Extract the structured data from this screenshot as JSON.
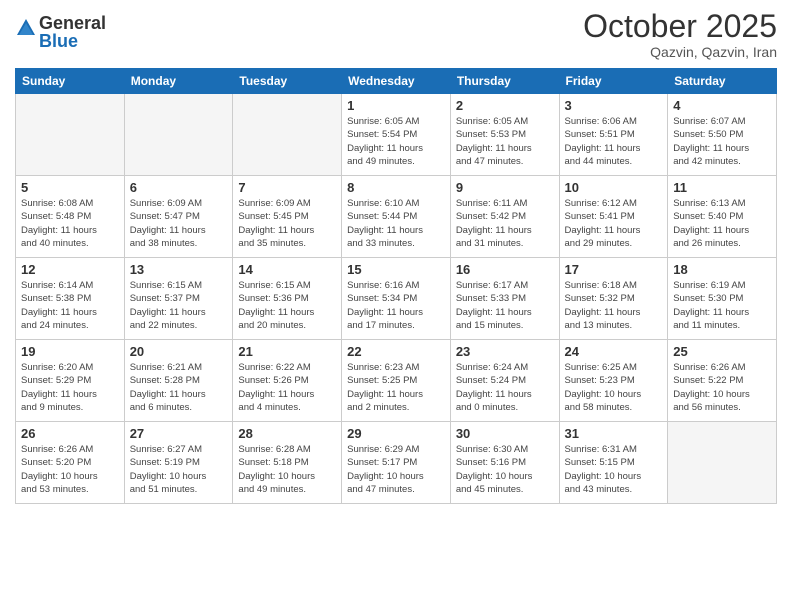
{
  "header": {
    "logo": {
      "general": "General",
      "blue": "Blue"
    },
    "month": "October 2025",
    "location": "Qazvin, Qazvin, Iran"
  },
  "weekdays": [
    "Sunday",
    "Monday",
    "Tuesday",
    "Wednesday",
    "Thursday",
    "Friday",
    "Saturday"
  ],
  "weeks": [
    [
      {
        "day": "",
        "info": ""
      },
      {
        "day": "",
        "info": ""
      },
      {
        "day": "",
        "info": ""
      },
      {
        "day": "1",
        "info": "Sunrise: 6:05 AM\nSunset: 5:54 PM\nDaylight: 11 hours\nand 49 minutes."
      },
      {
        "day": "2",
        "info": "Sunrise: 6:05 AM\nSunset: 5:53 PM\nDaylight: 11 hours\nand 47 minutes."
      },
      {
        "day": "3",
        "info": "Sunrise: 6:06 AM\nSunset: 5:51 PM\nDaylight: 11 hours\nand 44 minutes."
      },
      {
        "day": "4",
        "info": "Sunrise: 6:07 AM\nSunset: 5:50 PM\nDaylight: 11 hours\nand 42 minutes."
      }
    ],
    [
      {
        "day": "5",
        "info": "Sunrise: 6:08 AM\nSunset: 5:48 PM\nDaylight: 11 hours\nand 40 minutes."
      },
      {
        "day": "6",
        "info": "Sunrise: 6:09 AM\nSunset: 5:47 PM\nDaylight: 11 hours\nand 38 minutes."
      },
      {
        "day": "7",
        "info": "Sunrise: 6:09 AM\nSunset: 5:45 PM\nDaylight: 11 hours\nand 35 minutes."
      },
      {
        "day": "8",
        "info": "Sunrise: 6:10 AM\nSunset: 5:44 PM\nDaylight: 11 hours\nand 33 minutes."
      },
      {
        "day": "9",
        "info": "Sunrise: 6:11 AM\nSunset: 5:42 PM\nDaylight: 11 hours\nand 31 minutes."
      },
      {
        "day": "10",
        "info": "Sunrise: 6:12 AM\nSunset: 5:41 PM\nDaylight: 11 hours\nand 29 minutes."
      },
      {
        "day": "11",
        "info": "Sunrise: 6:13 AM\nSunset: 5:40 PM\nDaylight: 11 hours\nand 26 minutes."
      }
    ],
    [
      {
        "day": "12",
        "info": "Sunrise: 6:14 AM\nSunset: 5:38 PM\nDaylight: 11 hours\nand 24 minutes."
      },
      {
        "day": "13",
        "info": "Sunrise: 6:15 AM\nSunset: 5:37 PM\nDaylight: 11 hours\nand 22 minutes."
      },
      {
        "day": "14",
        "info": "Sunrise: 6:15 AM\nSunset: 5:36 PM\nDaylight: 11 hours\nand 20 minutes."
      },
      {
        "day": "15",
        "info": "Sunrise: 6:16 AM\nSunset: 5:34 PM\nDaylight: 11 hours\nand 17 minutes."
      },
      {
        "day": "16",
        "info": "Sunrise: 6:17 AM\nSunset: 5:33 PM\nDaylight: 11 hours\nand 15 minutes."
      },
      {
        "day": "17",
        "info": "Sunrise: 6:18 AM\nSunset: 5:32 PM\nDaylight: 11 hours\nand 13 minutes."
      },
      {
        "day": "18",
        "info": "Sunrise: 6:19 AM\nSunset: 5:30 PM\nDaylight: 11 hours\nand 11 minutes."
      }
    ],
    [
      {
        "day": "19",
        "info": "Sunrise: 6:20 AM\nSunset: 5:29 PM\nDaylight: 11 hours\nand 9 minutes."
      },
      {
        "day": "20",
        "info": "Sunrise: 6:21 AM\nSunset: 5:28 PM\nDaylight: 11 hours\nand 6 minutes."
      },
      {
        "day": "21",
        "info": "Sunrise: 6:22 AM\nSunset: 5:26 PM\nDaylight: 11 hours\nand 4 minutes."
      },
      {
        "day": "22",
        "info": "Sunrise: 6:23 AM\nSunset: 5:25 PM\nDaylight: 11 hours\nand 2 minutes."
      },
      {
        "day": "23",
        "info": "Sunrise: 6:24 AM\nSunset: 5:24 PM\nDaylight: 11 hours\nand 0 minutes."
      },
      {
        "day": "24",
        "info": "Sunrise: 6:25 AM\nSunset: 5:23 PM\nDaylight: 10 hours\nand 58 minutes."
      },
      {
        "day": "25",
        "info": "Sunrise: 6:26 AM\nSunset: 5:22 PM\nDaylight: 10 hours\nand 56 minutes."
      }
    ],
    [
      {
        "day": "26",
        "info": "Sunrise: 6:26 AM\nSunset: 5:20 PM\nDaylight: 10 hours\nand 53 minutes."
      },
      {
        "day": "27",
        "info": "Sunrise: 6:27 AM\nSunset: 5:19 PM\nDaylight: 10 hours\nand 51 minutes."
      },
      {
        "day": "28",
        "info": "Sunrise: 6:28 AM\nSunset: 5:18 PM\nDaylight: 10 hours\nand 49 minutes."
      },
      {
        "day": "29",
        "info": "Sunrise: 6:29 AM\nSunset: 5:17 PM\nDaylight: 10 hours\nand 47 minutes."
      },
      {
        "day": "30",
        "info": "Sunrise: 6:30 AM\nSunset: 5:16 PM\nDaylight: 10 hours\nand 45 minutes."
      },
      {
        "day": "31",
        "info": "Sunrise: 6:31 AM\nSunset: 5:15 PM\nDaylight: 10 hours\nand 43 minutes."
      },
      {
        "day": "",
        "info": ""
      }
    ]
  ]
}
